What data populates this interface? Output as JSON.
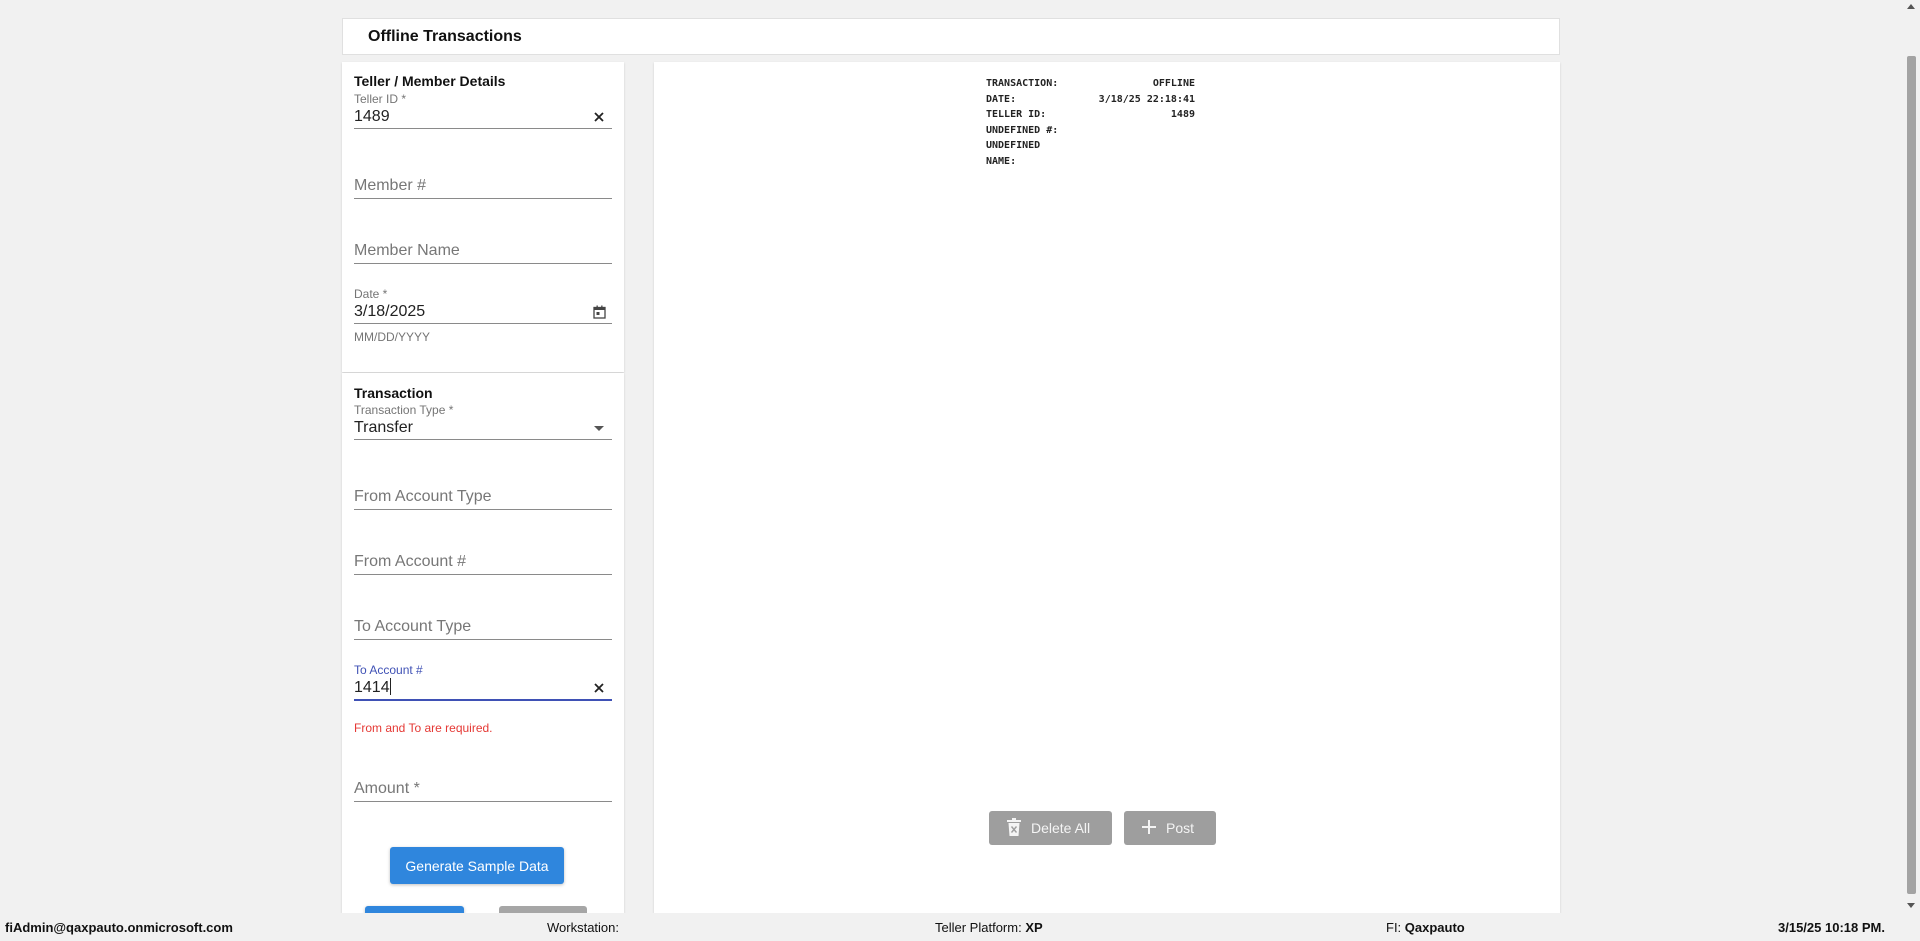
{
  "header": {
    "title": "Offline Transactions"
  },
  "teller_section": {
    "title": "Teller / Member Details",
    "teller_id": {
      "label": "Teller ID *",
      "value": "1489"
    },
    "member_number": {
      "placeholder": "Member #"
    },
    "member_name": {
      "placeholder": "Member Name"
    },
    "date": {
      "label": "Date *",
      "value": "3/18/2025",
      "helper": "MM/DD/YYYY"
    }
  },
  "transaction_section": {
    "title": "Transaction",
    "transaction_type": {
      "label": "Transaction Type *",
      "value": "Transfer"
    },
    "from_account_type": {
      "placeholder": "From Account Type"
    },
    "from_account_number": {
      "placeholder": "From Account #"
    },
    "to_account_type": {
      "placeholder": "To Account Type"
    },
    "to_account_number": {
      "label": "To Account #",
      "value": "1414",
      "error": "From and To are required."
    },
    "amount": {
      "placeholder": "Amount *"
    },
    "generate_button": "Generate Sample Data"
  },
  "receipt": {
    "rows": [
      {
        "key": "TRANSACTION:",
        "value": "OFFLINE"
      },
      {
        "key": "DATE:",
        "value": "3/18/25 22:18:41"
      },
      {
        "key": "TELLER ID:",
        "value": "1489"
      },
      {
        "key": "UNDEFINED #:",
        "value": ""
      },
      {
        "key": "UNDEFINED NAME:",
        "value": ""
      }
    ]
  },
  "actions": {
    "delete_all": "Delete All",
    "post": "Post"
  },
  "status_bar": {
    "user": "fiAdmin@qaxpauto.onmicrosoft.com",
    "workstation_label": "Workstation:",
    "workstation_value": "",
    "platform_label": "Teller Platform:",
    "platform_value": "XP",
    "fi_label": "FI:",
    "fi_value": "Qaxpauto",
    "datetime": "3/15/25 10:18 PM."
  },
  "colors": {
    "primary": "#2f86dd",
    "focus": "#3f51b5",
    "error": "#e53935",
    "disabled_button": "#9e9e9e"
  }
}
